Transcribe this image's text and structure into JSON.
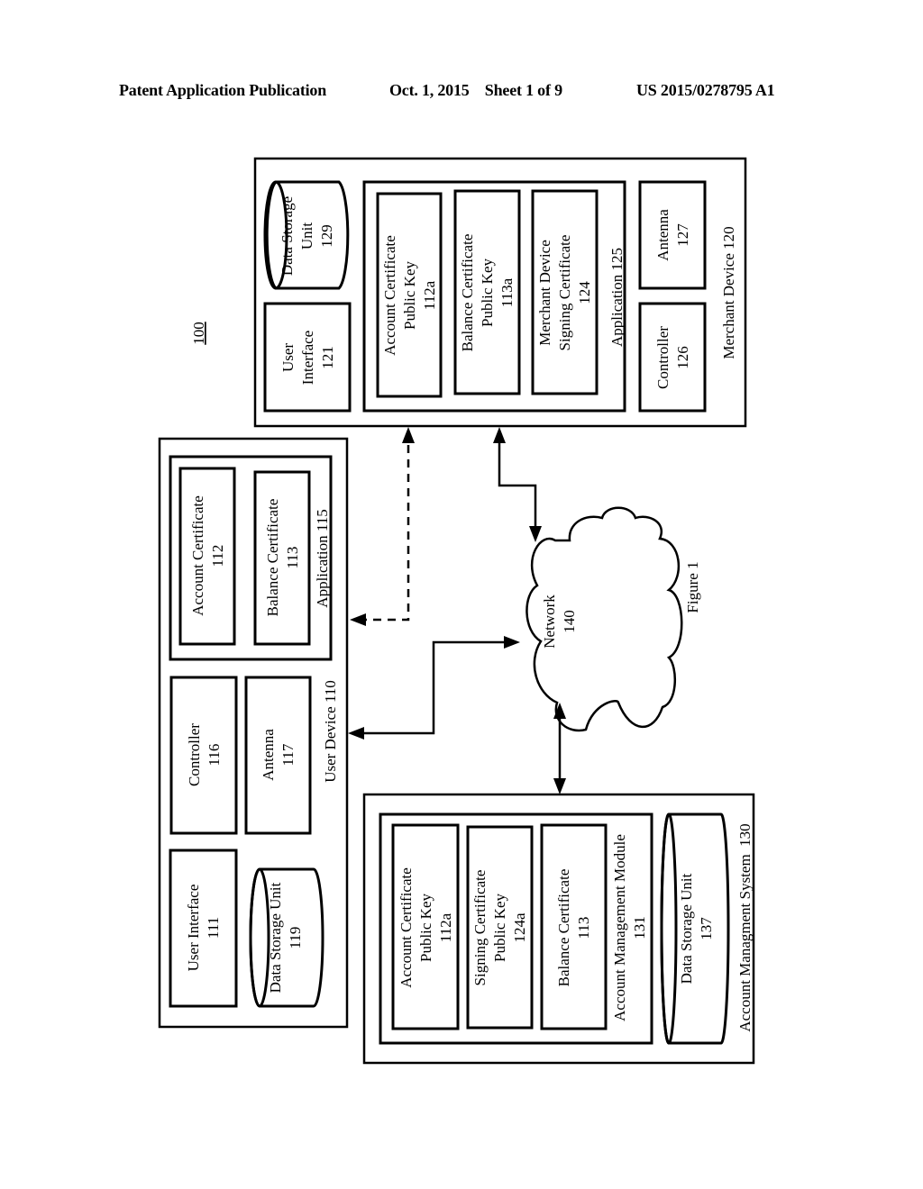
{
  "header": {
    "publication": "Patent Application Publication",
    "date_sheet": "Oct. 1, 2015    Sheet 1 of 9",
    "number": "US 2015/0278795 A1"
  },
  "figure": {
    "ref": "100",
    "caption": "Figure 1",
    "merchant_device": {
      "title": "Merchant Device 120",
      "user_interface": [
        "User",
        "Interface",
        "121"
      ],
      "data_storage": [
        "Data Storage",
        "Unit",
        "129"
      ],
      "application": {
        "title": "Application 125",
        "items": [
          [
            "Account Certificate",
            "Public Key",
            "112a"
          ],
          [
            "Balance Certificate",
            "Public Key",
            "113a"
          ],
          [
            "Merchant Device",
            "Signing Certificate",
            "124"
          ]
        ]
      },
      "controller": [
        "Controller",
        "126"
      ],
      "antenna": [
        "Antenna",
        "127"
      ]
    },
    "user_device": {
      "title": "User Device 110",
      "user_interface": [
        "User Interface",
        "111"
      ],
      "data_storage": [
        "Data Storage Unit",
        "119"
      ],
      "controller": [
        "Controller",
        "116"
      ],
      "antenna": [
        "Antenna",
        "117"
      ],
      "application": {
        "title": "Application 115",
        "items": [
          [
            "Account Certificate",
            "112"
          ],
          [
            "Balance Certificate",
            "113"
          ]
        ]
      }
    },
    "network": [
      "Network",
      "140"
    ],
    "account_system": {
      "title": "Account Managment System  130",
      "module": {
        "title": [
          "Account Management Module",
          "131"
        ],
        "items": [
          [
            "Account Certificate",
            "Public Key",
            "112a"
          ],
          [
            "Signing Certificate",
            "Public Key",
            "124a"
          ],
          [
            "Balance Certificate",
            "113"
          ]
        ]
      },
      "data_storage": [
        "Data Storage Unit",
        "137"
      ]
    }
  }
}
